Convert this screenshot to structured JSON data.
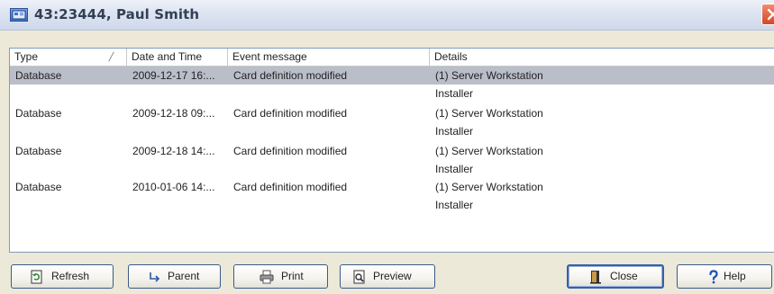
{
  "window": {
    "title": "43:23444, Paul Smith"
  },
  "columns": [
    {
      "label": "Type"
    },
    {
      "label": "Date and Time"
    },
    {
      "label": "Event message"
    },
    {
      "label": "Details"
    }
  ],
  "rows": [
    {
      "type": "Database",
      "datetime": "2009-12-17 16:...",
      "message": "Card definition modified",
      "details": "(1) Server Workstation",
      "details2": "Installer",
      "selected": true
    },
    {
      "type": "Database",
      "datetime": "2009-12-18 09:...",
      "message": "Card definition modified",
      "details": "(1) Server Workstation",
      "details2": "Installer"
    },
    {
      "type": "Database",
      "datetime": "2009-12-18 14:...",
      "message": "Card definition modified",
      "details": "(1) Server Workstation",
      "details2": "Installer"
    },
    {
      "type": "Database",
      "datetime": "2010-01-06 14:...",
      "message": "Card definition modified",
      "details": "(1) Server Workstation",
      "details2": "Installer"
    }
  ],
  "buttons": {
    "refresh": "Refresh",
    "parent": "Parent",
    "print": "Print",
    "preview": "Preview",
    "close": "Close",
    "help": "Help"
  },
  "icons": {
    "title": "app-window-icon",
    "refresh": "refresh-icon",
    "parent": "parent-arrow-icon",
    "print": "printer-icon",
    "preview": "magnifier-preview-icon",
    "close": "door-exit-icon",
    "help": "question-mark-icon"
  },
  "colors": {
    "selected_row": "#b9bec9",
    "list_border": "#7f9db9",
    "close_red": "#d2472a"
  }
}
